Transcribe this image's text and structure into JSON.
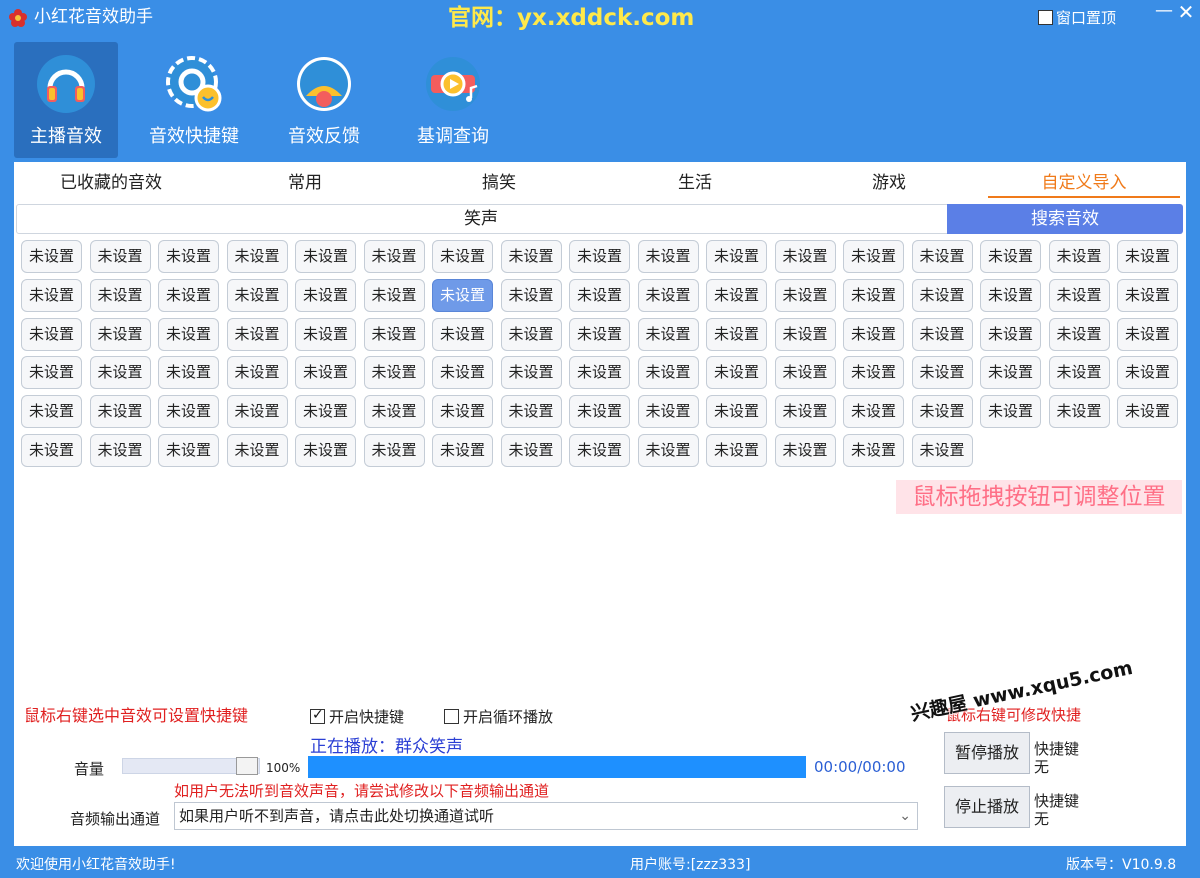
{
  "window": {
    "title": "小红花音效助手",
    "site_url": "官网：yx.xddck.com",
    "pin_label": "窗口置顶",
    "pin_checked": false,
    "min_symbol": "—",
    "close_symbol": "✕"
  },
  "toolbar": {
    "items": [
      {
        "label": "主播音效",
        "icon": "headphones-icon",
        "active": true
      },
      {
        "label": "音效快捷键",
        "icon": "settings-gear-icon",
        "active": false
      },
      {
        "label": "音效反馈",
        "icon": "feedback-avatar-icon",
        "active": false
      },
      {
        "label": "基调查询",
        "icon": "music-player-icon",
        "active": false
      }
    ]
  },
  "category_tabs": [
    {
      "label": "已收藏的音效",
      "active": false
    },
    {
      "label": "常用",
      "active": false
    },
    {
      "label": "搞笑",
      "active": false
    },
    {
      "label": "生活",
      "active": false
    },
    {
      "label": "游戏",
      "active": false
    },
    {
      "label": "自定义导入",
      "active": true
    }
  ],
  "sub_tabs": {
    "laugh": "笑声",
    "search": "搜索音效"
  },
  "sound_grid": {
    "button_label": "未设置",
    "columns": 17,
    "total": 99,
    "selected_index": 23
  },
  "drag_hint": "鼠标拖拽按钮可调整位置",
  "controls": {
    "right_click_hint": "鼠标右键选中音效可设置快捷键",
    "enable_hotkey_label": "开启快捷键",
    "enable_hotkey_checked": true,
    "loop_play_label": "开启循环播放",
    "loop_play_checked": false,
    "now_playing": "正在播放：群众笑声",
    "right_click_modify_hint": "鼠标右键可修改快捷",
    "volume_label": "音量",
    "volume_percent": "100%",
    "volume_value": 1.0,
    "progress_value": 1.0,
    "time": "00:00/00:00",
    "channel_hint": "如用户无法听到音效声音，请尝试修改以下音频输出通道",
    "channel_label": "音频输出通道",
    "channel_selected": "如果用户听不到声音，请点击此处切换通道试听",
    "play_button": "暂停播放",
    "stop_button": "停止播放",
    "hotkey_label": "快捷键",
    "hotkey_value": "无"
  },
  "status": {
    "welcome": "欢迎使用小红花音效助手!",
    "user": "用户账号:[zzz333]",
    "version": "版本号：V10.9.8"
  },
  "watermark": "兴趣屋 www.xqu5.com",
  "colors": {
    "frame_blue": "#3a8ee6",
    "active_orange": "#f07a1a",
    "search_blue": "#5b7fe6",
    "hint_red": "#e02020",
    "progress_blue": "#1e90ff",
    "url_yellow": "#ffe94a"
  }
}
